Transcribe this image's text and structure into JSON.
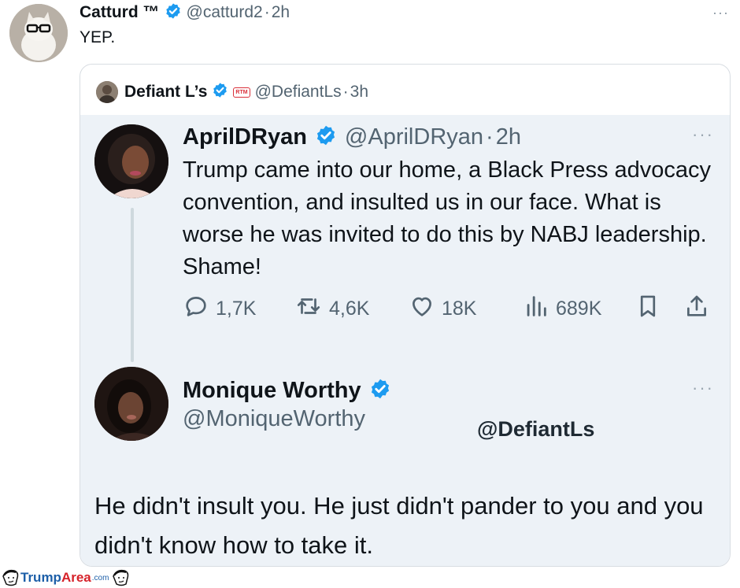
{
  "outer_tweet": {
    "name": "Catturd ™",
    "handle": "@catturd2",
    "separator": "·",
    "time": "2h",
    "text": "YEP.",
    "more": "···"
  },
  "quote": {
    "name": "Defiant L’s",
    "badge": "RTM",
    "handle": "@DefiantLs",
    "separator": "·",
    "time": "3h"
  },
  "screenshot": {
    "tweet1": {
      "name": "AprilDRyan",
      "handle": "@AprilDRyan",
      "separator": "·",
      "time": "2h",
      "text": "Trump came into our home, a Black Press advocacy convention, and insulted us in our face. What is worse he was invited to do this by NABJ leadership. Shame!",
      "more": "···",
      "replies": "1,7K",
      "reposts": "4,6K",
      "likes": "18K",
      "views": "689K"
    },
    "tweet2": {
      "name": "Monique Worthy",
      "handle": "@MoniqueWorthy",
      "more": "···",
      "tag": "@DefiantLs",
      "text": "He didn't insult you. He just didn't pander to you and you didn't know how to take it."
    }
  },
  "site_watermark": {
    "trump": "Trump",
    "area": "Area",
    "com": ".com"
  },
  "colors": {
    "verified": "#1d9bf0",
    "secondary_text": "#536471",
    "screenshot_bg": "#edf2f7",
    "logo_blue": "#1d5fa8",
    "logo_red": "#d6222a"
  }
}
